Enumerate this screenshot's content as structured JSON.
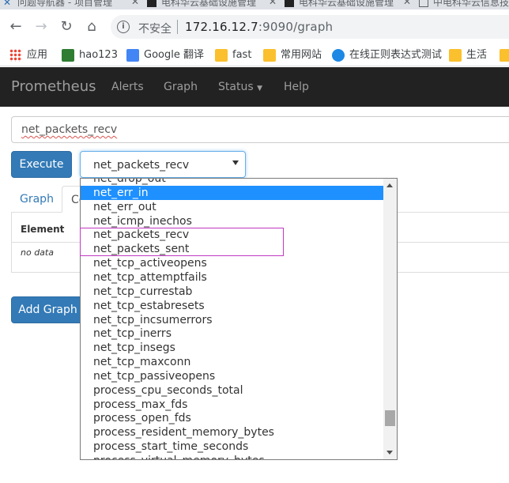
{
  "browser": {
    "tabs": [
      {
        "title": "问题导航器 - 项目管理",
        "active": false
      },
      {
        "title": "电科华云基础设施管理",
        "active": false
      },
      {
        "title": "电科华云基础设施管理",
        "active": true
      },
      {
        "title": "中电科华云信息技术",
        "active": false
      }
    ],
    "address": {
      "insecure_label": "不安全",
      "host": "172.16.12.7",
      "port_path": ":9090/graph"
    },
    "bookmarks": [
      "应用",
      "hao123",
      "Google 翻译",
      "fast",
      "常用网站",
      "在线正则表达式测试",
      "生活"
    ]
  },
  "nav": {
    "brand": "Prometheus",
    "links": [
      "Alerts",
      "Graph",
      "Status",
      "Help"
    ]
  },
  "expression": {
    "value": "net_packets_recv"
  },
  "execute_label": "Execute",
  "metric_select": {
    "selected": "net_packets_recv"
  },
  "panel_tabs": {
    "graph": "Graph",
    "console": "Console"
  },
  "table": {
    "header": "Element",
    "empty": "no data"
  },
  "add_graph_label": "Add Graph",
  "dropdown": {
    "highlighted_index": 1,
    "options": [
      "net_drop_out",
      "net_err_in",
      "net_err_out",
      "net_icmp_inechos",
      "net_packets_recv",
      "net_packets_sent",
      "net_tcp_activeopens",
      "net_tcp_attemptfails",
      "net_tcp_currestab",
      "net_tcp_estabresets",
      "net_tcp_incsumerrors",
      "net_tcp_inerrs",
      "net_tcp_insegs",
      "net_tcp_maxconn",
      "net_tcp_passiveopens",
      "process_cpu_seconds_total",
      "process_max_fds",
      "process_open_fds",
      "process_resident_memory_bytes",
      "process_start_time_seconds",
      "process_virtual_memory_bytes"
    ]
  },
  "colors": {
    "navbar": "#222222",
    "primary": "#337ab7",
    "selection": "#1e90ff",
    "annotation": "#c238c2"
  }
}
